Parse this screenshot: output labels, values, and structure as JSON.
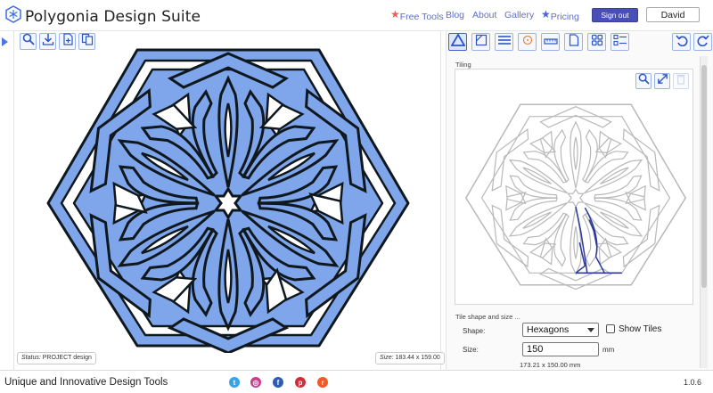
{
  "app": {
    "title": "Polygonia Design Suite"
  },
  "nav": {
    "free_tools": "Free Tools",
    "blog": "Blog",
    "about": "About",
    "gallery": "Gallery",
    "pricing": "Pricing",
    "sign_out": "Sign out",
    "user": "David"
  },
  "canvas": {
    "status_label": "Status:",
    "status_value": "PROJECT design",
    "size_label": "Size:",
    "size_value": "183.44 x 159.00"
  },
  "right_panel": {
    "tiling_label": "Tiling",
    "shape_heading": "Tile shape and size ...",
    "shape_label": "Shape:",
    "shape_value": "Hexagons",
    "show_tiles_label": "Show Tiles",
    "size_label": "Size:",
    "size_value": "150",
    "size_unit": "mm",
    "dimensions": "173.21 x 150.00  mm"
  },
  "footer": {
    "tagline": "Unique and Innovative Design Tools",
    "version": "1.0.6"
  },
  "colors": {
    "accent": "#4a74e8",
    "design_fill": "#7fa6ea",
    "sign_out_bg": "#4a4fb8",
    "link": "#5f6ecf",
    "star_red": "#f05a5a"
  },
  "icons": {
    "brand": "snowflake-hex-icon",
    "toolbar_left": [
      "zoom-icon",
      "download-icon",
      "add-file-icon",
      "copy-icon"
    ],
    "toolbar_right": [
      "triangle-icon",
      "tile-corner-icon",
      "lines-icon",
      "target-icon",
      "ruler-icon",
      "page-icon",
      "grid-icon",
      "list-icon",
      "undo-icon",
      "redo-icon"
    ],
    "tiling_tools": [
      "zoom-icon",
      "expand-icon",
      "trash-icon"
    ],
    "social": [
      "twitter-icon",
      "instagram-icon",
      "facebook-icon",
      "pinterest-icon",
      "reddit-icon"
    ]
  }
}
